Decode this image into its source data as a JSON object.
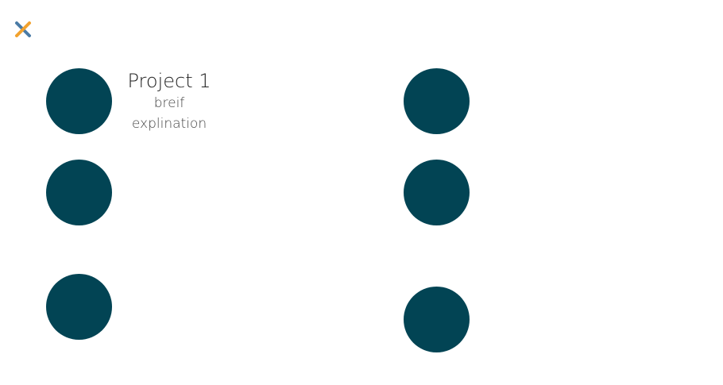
{
  "colors": {
    "circle": "#024454",
    "close_primary": "#F2A22E",
    "close_secondary": "#4A7BA6"
  },
  "close_button": {
    "icon": "close-icon"
  },
  "projects": [
    {
      "title": "Project 1",
      "description_line1": "breif",
      "description_line2": "explination"
    }
  ]
}
